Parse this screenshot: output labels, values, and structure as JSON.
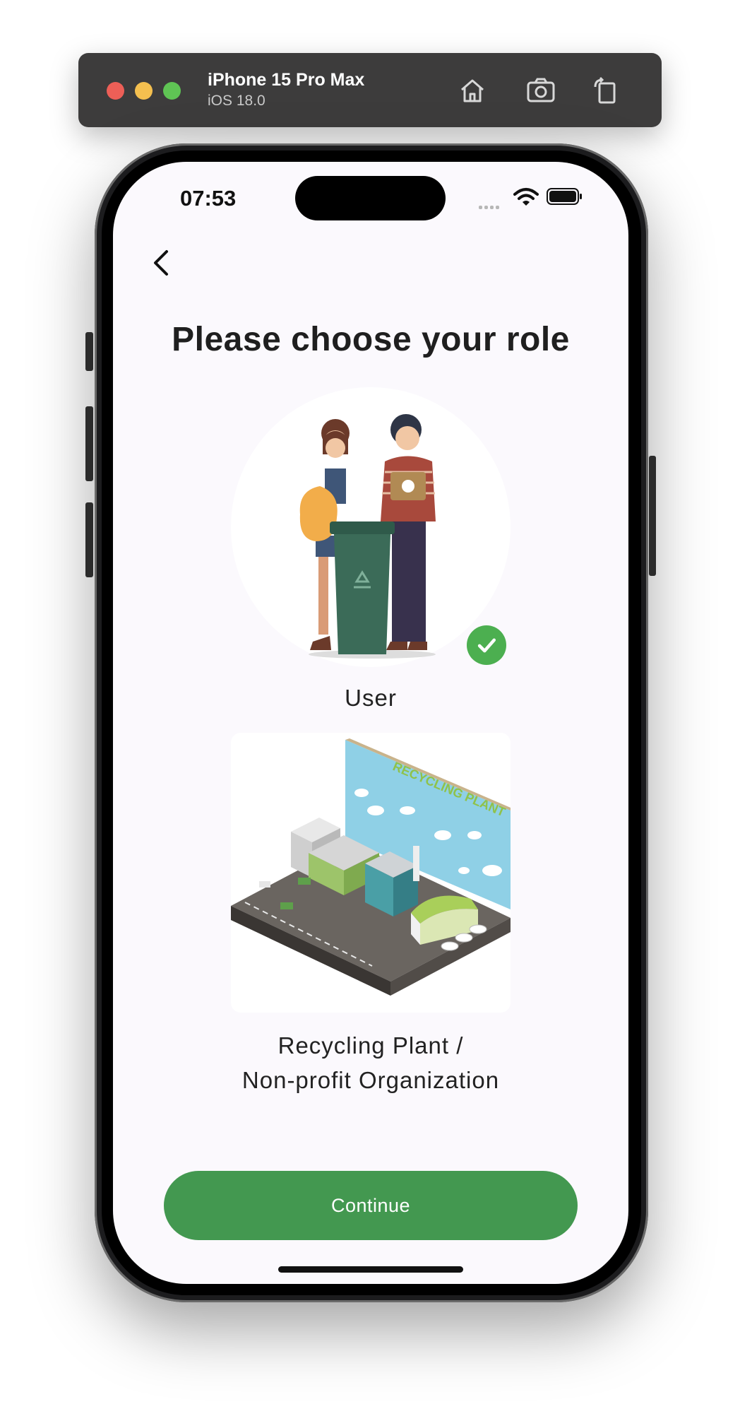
{
  "simulator": {
    "device_name": "iPhone 15 Pro Max",
    "os_version": "iOS 18.0",
    "tools": [
      "home-icon",
      "screenshot-icon",
      "rotate-icon"
    ]
  },
  "status_bar": {
    "time": "07:53",
    "icons": [
      "signal-dots-icon",
      "wifi-icon",
      "battery-icon"
    ]
  },
  "header": {
    "back_icon": "chevron-left-icon",
    "title": "Please choose your role"
  },
  "roles": [
    {
      "label": "User",
      "selected": true,
      "badge_icon": "checkmark-icon"
    },
    {
      "label_line1": "Recycling Plant /",
      "label_line2": "Non-profit Organization",
      "selected": false,
      "sign_text": "RECYCLING PLANT"
    }
  ],
  "footer": {
    "continue_label": "Continue"
  },
  "colors": {
    "accent": "#439850",
    "check": "#4caf50",
    "screen_bg": "#fbf9fd"
  }
}
